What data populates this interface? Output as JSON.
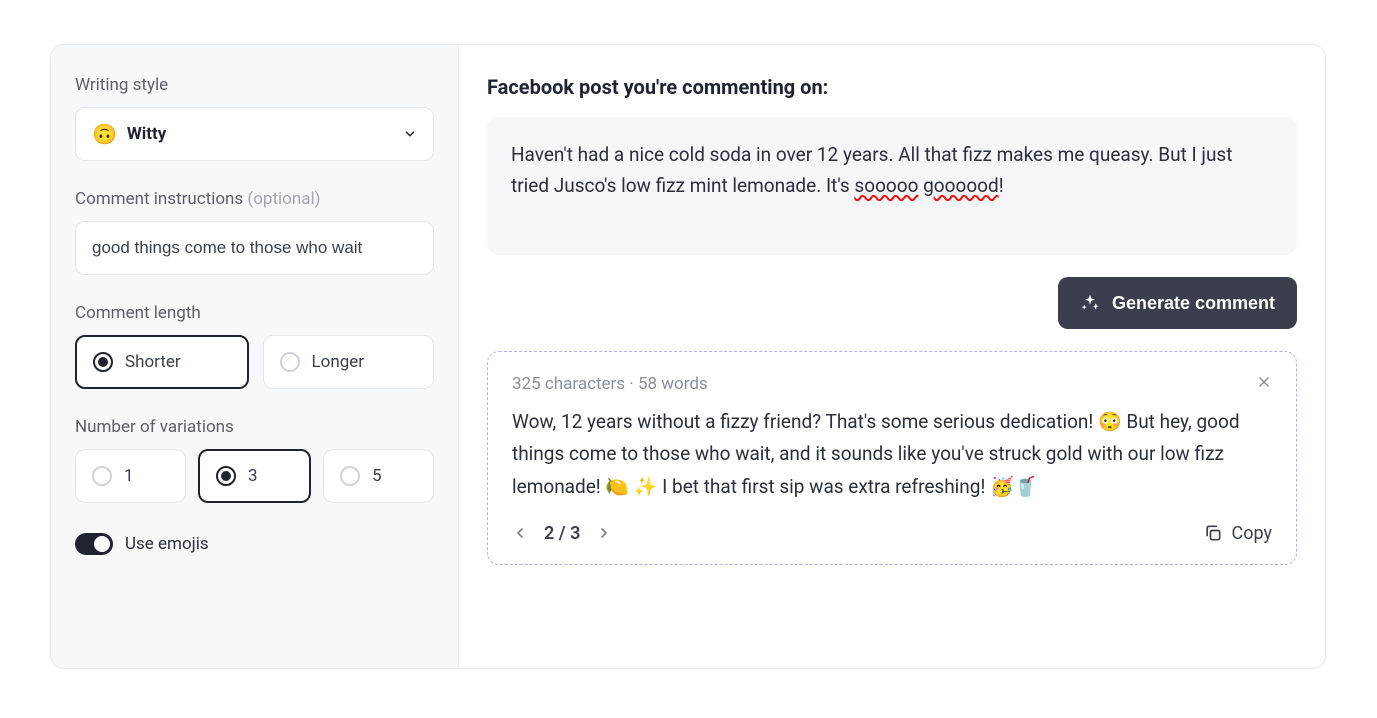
{
  "sidebar": {
    "writing_style": {
      "label": "Writing style",
      "emoji": "🙃",
      "value": "Witty"
    },
    "instructions": {
      "label": "Comment instructions ",
      "optional": "(optional)",
      "value": "good things come to those who wait"
    },
    "length": {
      "label": "Comment length",
      "options": [
        "Shorter",
        "Longer"
      ],
      "selected": "Shorter"
    },
    "variations": {
      "label": "Number of variations",
      "options": [
        "1",
        "3",
        "5"
      ],
      "selected": "3"
    },
    "emojis": {
      "label": "Use emojis",
      "on": true
    }
  },
  "main": {
    "title": "Facebook post you're commenting on:",
    "post_prefix": "Haven't had a nice cold soda in over 12 years. All that fizz makes me queasy. But I just tried Jusco's low fizz mint lemonade. It's ",
    "post_word1": "sooooo",
    "post_sep": " ",
    "post_word2": "goooood",
    "post_suffix": "!",
    "generate_label": "Generate comment"
  },
  "result": {
    "meta": "325 characters · 58 words",
    "body": "Wow, 12 years without a fizzy friend? That's some serious dedication! 😳 But hey, good things come to those who wait, and it sounds like you've struck gold with our low fizz lemonade! 🍋 ✨ I bet that first sip was extra refreshing! 🥳🥤",
    "page_current": "2",
    "page_total": "3",
    "copy_label": "Copy"
  }
}
